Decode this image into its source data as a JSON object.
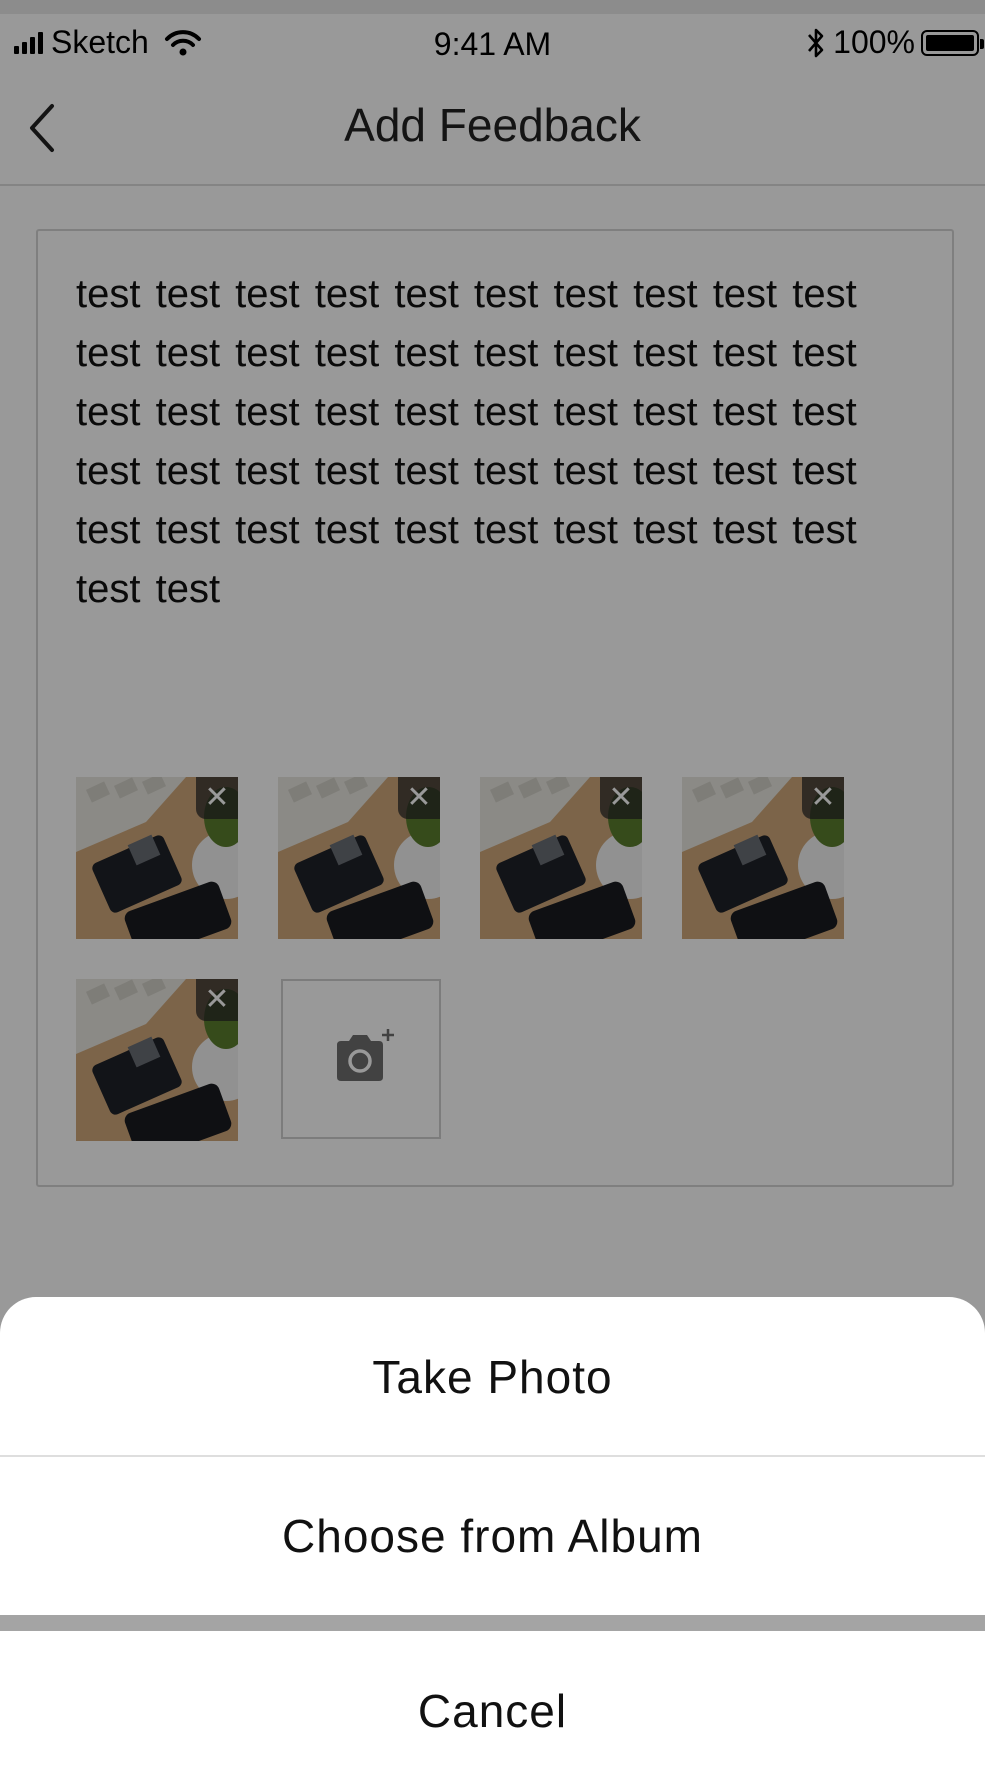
{
  "status_bar": {
    "carrier": "Sketch",
    "time": "9:41 AM",
    "battery": "100%"
  },
  "nav": {
    "title": "Add Feedback",
    "back_icon": "chevron-left-icon"
  },
  "feedback": {
    "text": "test test test test test test test test test test test test test test test test test test test test test test test test test test test test test test test test test test test test test test test test test test test test test test test test test test test test"
  },
  "attachments": {
    "count": 5,
    "remove_icon": "close-icon",
    "add_icon": "camera-plus-icon"
  },
  "action_sheet": {
    "take_photo": "Take Photo",
    "choose_album": "Choose from Album",
    "cancel": "Cancel"
  },
  "colors": {
    "overlay": "#000000",
    "sheet_bg": "#ffffff",
    "text": "#111111"
  }
}
